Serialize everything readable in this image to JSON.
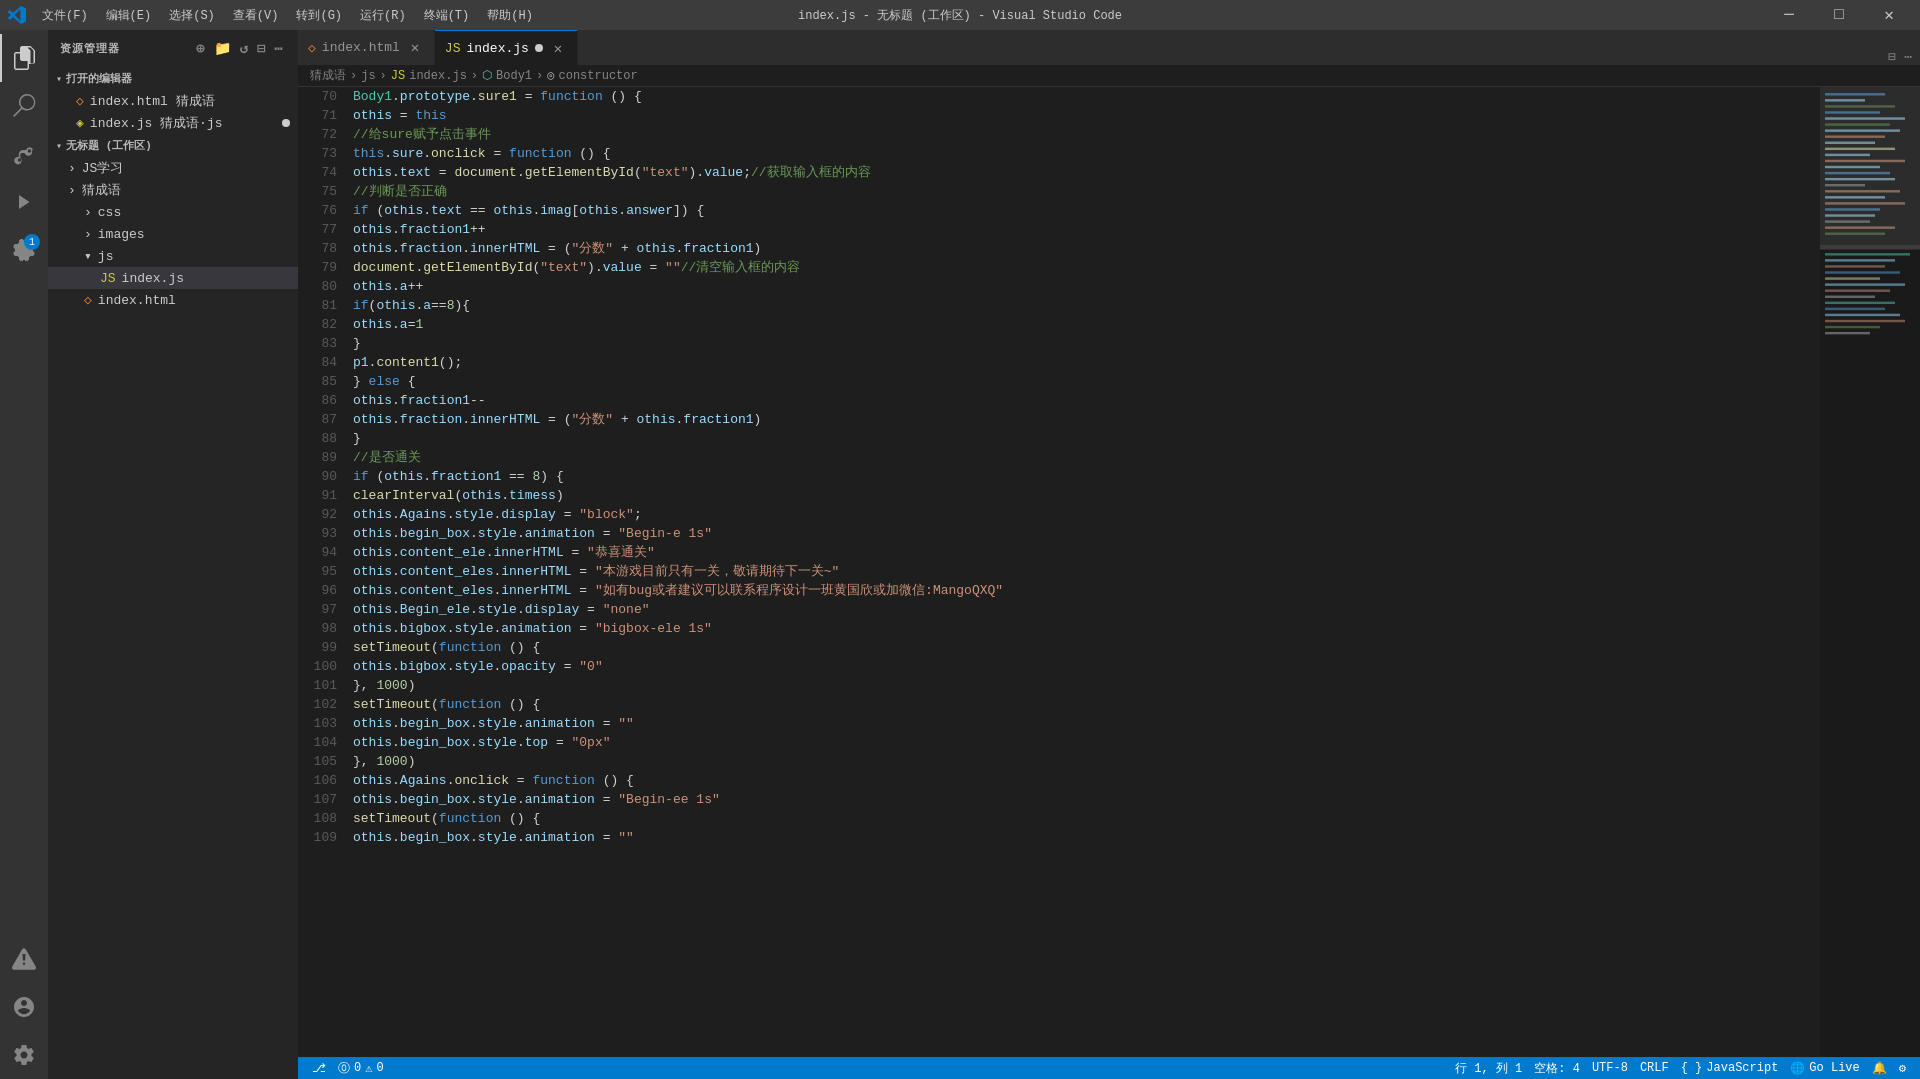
{
  "titleBar": {
    "title": "index.js - 无标题 (工作区) - Visual Studio Code",
    "menus": [
      "文件(F)",
      "编辑(E)",
      "选择(S)",
      "查看(V)",
      "转到(G)",
      "运行(R)",
      "终端(T)",
      "帮助(H)"
    ],
    "buttons": [
      "_",
      "□",
      "×"
    ]
  },
  "sidebar": {
    "header": "资源管理器",
    "sections": {
      "openEditors": {
        "label": "打开的编辑器",
        "items": [
          {
            "name": "index.html 猜成语",
            "icon": "html",
            "modified": false
          },
          {
            "name": "index.js 猜成语·js",
            "icon": "js",
            "modified": true
          }
        ]
      },
      "workspace": {
        "label": "无标题 (工作区)",
        "items": [
          {
            "name": "JS学习",
            "type": "folder"
          },
          {
            "name": "猜成语",
            "type": "folder",
            "expanded": true,
            "children": [
              {
                "name": "css",
                "type": "folder"
              },
              {
                "name": "images",
                "type": "folder"
              },
              {
                "name": "js",
                "type": "folder",
                "expanded": true,
                "children": [
                  {
                    "name": "index.js",
                    "type": "js",
                    "active": true
                  }
                ]
              },
              {
                "name": "index.html",
                "type": "html"
              }
            ]
          }
        ]
      }
    }
  },
  "tabs": [
    {
      "label": "index.html",
      "icon": "html",
      "active": false,
      "modified": false
    },
    {
      "label": "index.js",
      "icon": "js",
      "active": true,
      "modified": true
    }
  ],
  "breadcrumb": {
    "items": [
      "猜成语",
      "js",
      "JS index.js",
      "Body1",
      "constructor"
    ]
  },
  "code": {
    "startLine": 70,
    "lines": [
      "Body1.prototype.sure1 = function () {",
      "    othis = this",
      "    //给sure赋予点击事件",
      "    this.sure.onclick = function () {",
      "        othis.text = document.getElementById(\"text\").value;//获取输入框的内容",
      "        //判断是否正确",
      "        if (othis.text == othis.imag[othis.answer]) {",
      "            othis.fraction1++",
      "            othis.fraction.innerHTML = (\"分数\" + othis.fraction1)",
      "            document.getElementById(\"text\").value = \"\"//清空输入框的内容",
      "            othis.a++",
      "            if(othis.a==8){",
      "                othis.a=1",
      "            }",
      "            p1.content1();",
      "        } else {",
      "            othis.fraction1--",
      "            othis.fraction.innerHTML = (\"分数\" + othis.fraction1)",
      "        }",
      "        //是否通关",
      "        if (othis.fraction1 == 8) {",
      "            clearInterval(othis.timess)",
      "            othis.Agains.style.display = \"block\";",
      "            othis.begin_box.style.animation = \"Begin-e 1s\"",
      "            othis.content_ele.innerHTML = \"恭喜通关\"",
      "            othis.content_eles.innerHTML = \"本游戏目前只有一关，敬请期待下一关~\"",
      "            othis.content_eles.innerHTML = \"如有bug或者建议可以联系程序设计一班黄国欣或加微信:MangoQXQ\"",
      "            othis.Begin_ele.style.display = \"none\"",
      "            othis.bigbox.style.animation = \"bigbox-ele 1s\"",
      "            setTimeout(function () {",
      "                othis.bigbox.style.opacity = \"0\"",
      "            }, 1000)",
      "            setTimeout(function () {",
      "                othis.begin_box.style.animation = \"\"",
      "                othis.begin_box.style.top = \"0px\"",
      "            }, 1000)",
      "            othis.Agains.onclick = function () {",
      "                othis.begin_box.style.animation = \"Begin-ee 1s\"",
      "                setTimeout(function () {",
      "                    othis.begin_box.style.animation = \"\""
    ]
  },
  "statusBar": {
    "left": [
      {
        "text": "⎇"
      },
      {
        "text": "⓪ 0 ⚠ 0"
      }
    ],
    "right": [
      {
        "text": "行 1, 列 1"
      },
      {
        "text": "空格: 4"
      },
      {
        "text": "UTF-8"
      },
      {
        "text": "CRLF"
      },
      {
        "text": "{ } JavaScript"
      },
      {
        "text": "🌐 Go Live"
      },
      {
        "text": "🔔"
      },
      {
        "text": "⚙"
      }
    ]
  }
}
